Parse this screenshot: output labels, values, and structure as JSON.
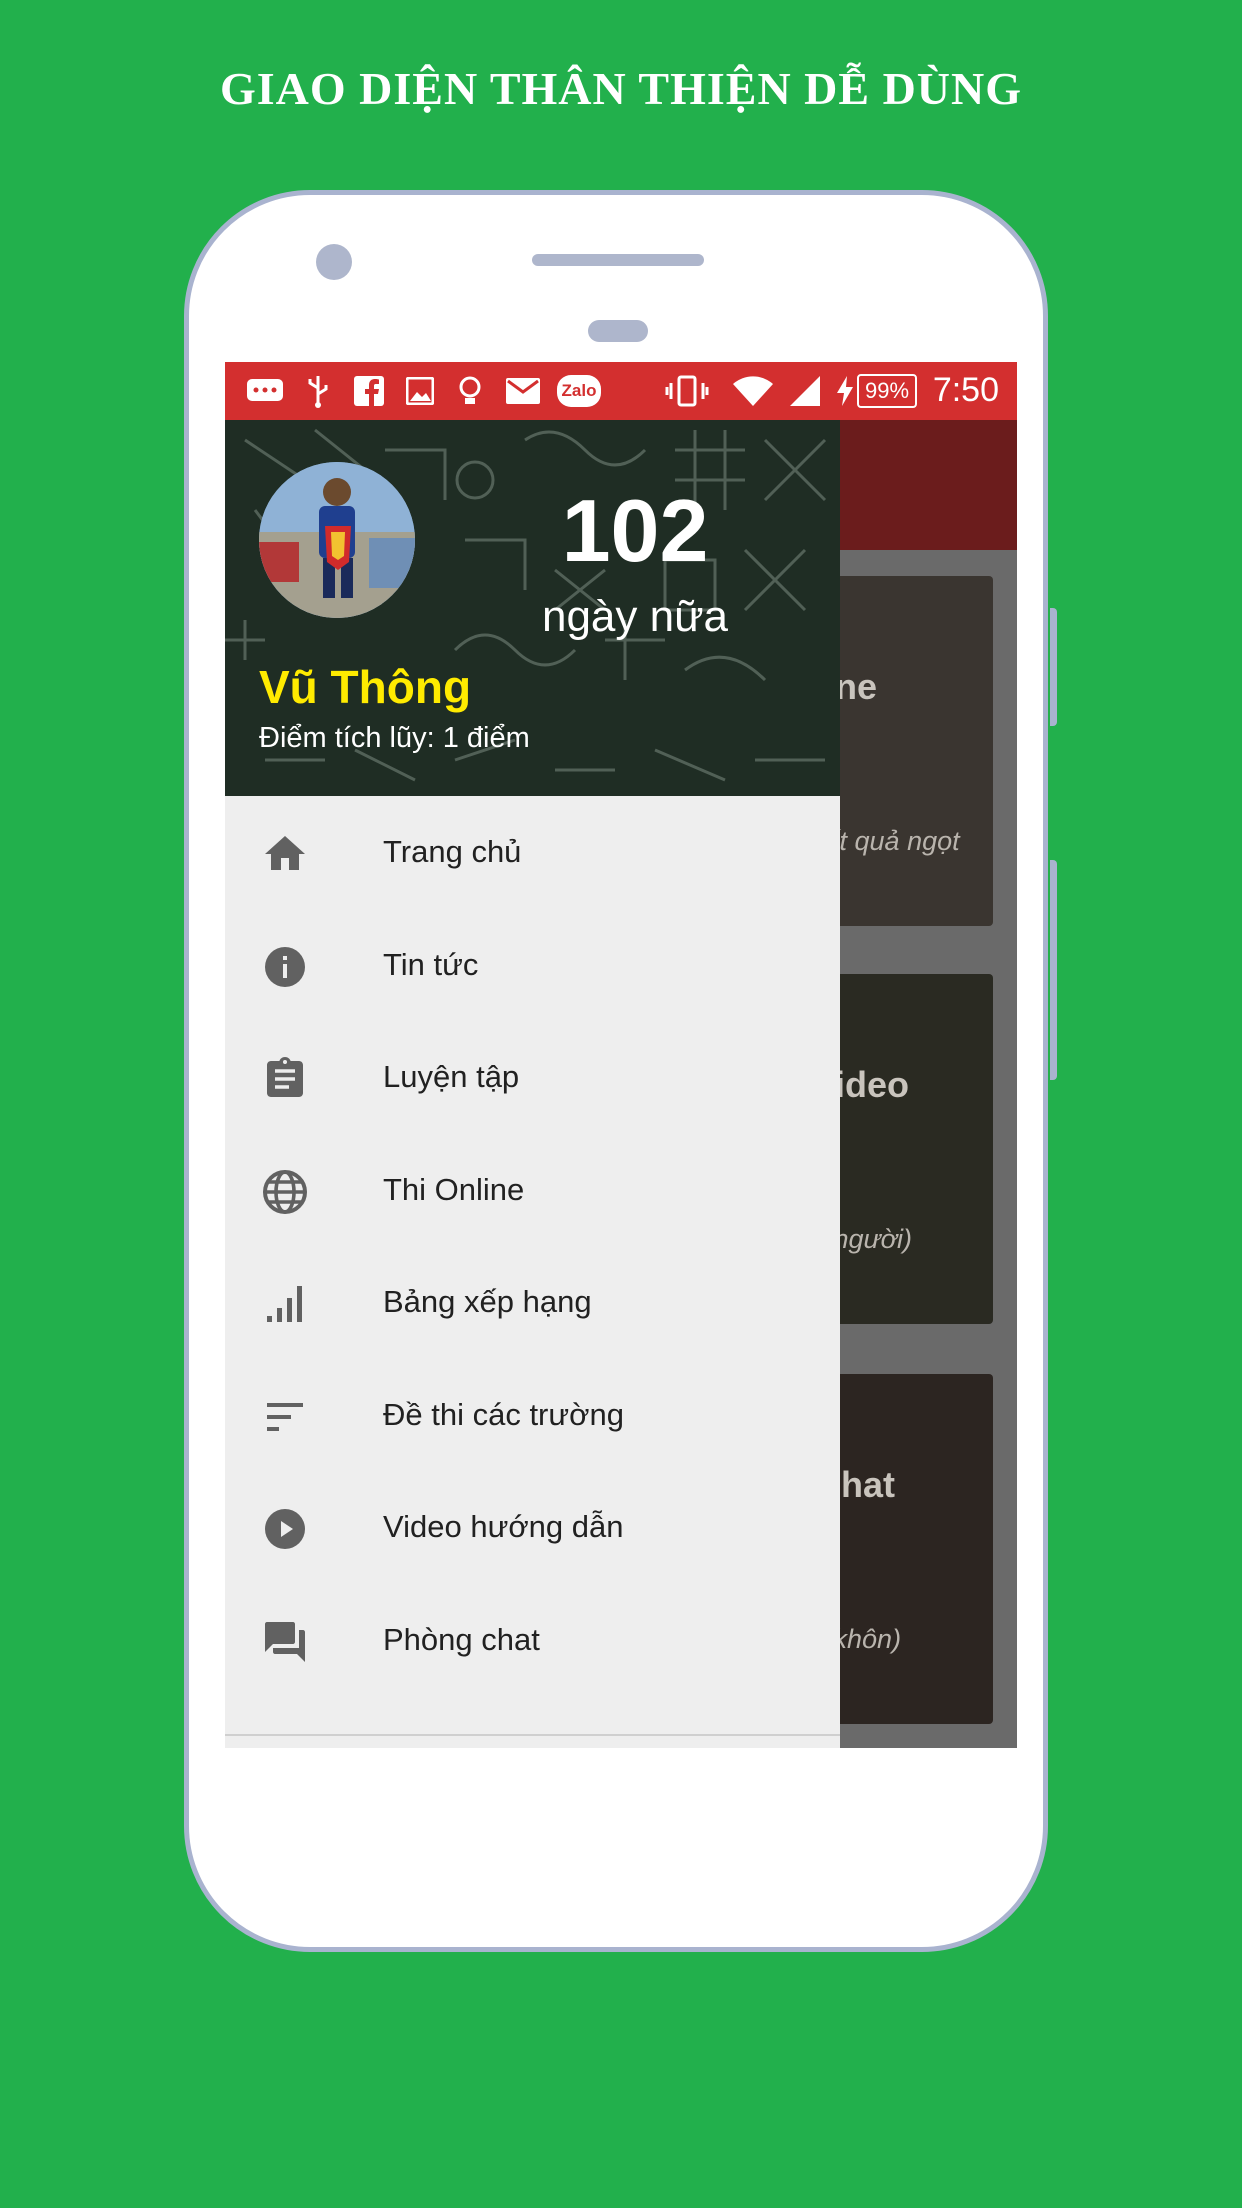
{
  "headline": "GIAO DIỆN THÂN THIỆN DỄ DÙNG",
  "statusbar": {
    "icons": [
      "chat-bubble-icon",
      "usb-icon",
      "facebook-icon",
      "image-icon",
      "bulb-icon",
      "mail-icon",
      "zalo-icon",
      "vibrate-icon",
      "wifi-icon",
      "signal-icon",
      "charging-icon"
    ],
    "zalo_label": "Zalo",
    "battery": "99%",
    "time": "7:50"
  },
  "drawer": {
    "header": {
      "countdown_number": "102",
      "countdown_label": "ngày nữa",
      "user_name": "Vũ Thông",
      "user_points": "Điểm tích lũy: 1 điểm"
    },
    "menu": [
      {
        "label": "Trang chủ",
        "icon": "home-icon"
      },
      {
        "label": "Tin tức",
        "icon": "info-icon"
      },
      {
        "label": "Luyện tập",
        "icon": "clipboard-icon"
      },
      {
        "label": "Thi Online",
        "icon": "globe-icon"
      },
      {
        "label": "Bảng xếp hạng",
        "icon": "signal-bars-icon"
      },
      {
        "label": "Đề thi các trường",
        "icon": "sort-lines-icon"
      },
      {
        "label": "Video hướng dẫn",
        "icon": "play-circle-icon"
      },
      {
        "label": "Phòng chat",
        "icon": "forum-icon"
      }
    ]
  },
  "background_cards": [
    {
      "title": "line",
      "subtitle": "kết quả ngọt"
    },
    {
      "title": "video",
      "subtitle": "n người)"
    },
    {
      "title": "Chat",
      "subtitle": "ố khôn)"
    }
  ],
  "colors": {
    "page_background": "#22b04c",
    "statusbar": "#d32f2f",
    "user_name": "#ffeb00",
    "drawer_background": "#eeeeee",
    "menu_icon": "#616161"
  }
}
